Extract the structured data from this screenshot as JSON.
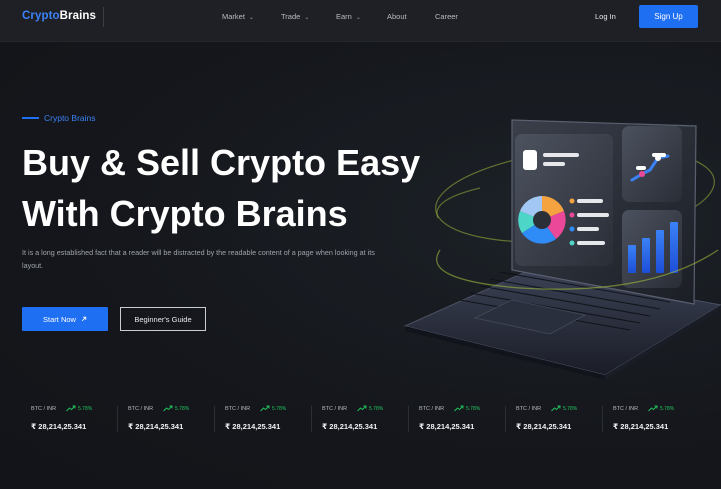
{
  "brand": {
    "part1": "Crypto",
    "part2": "Brains"
  },
  "nav": {
    "items": [
      {
        "label": "Market",
        "has_dropdown": true
      },
      {
        "label": "Trade",
        "has_dropdown": true
      },
      {
        "label": "Earn",
        "has_dropdown": true
      },
      {
        "label": "About",
        "has_dropdown": false
      },
      {
        "label": "Career",
        "has_dropdown": false
      }
    ],
    "login": "Log In",
    "signup": "Sign Up"
  },
  "hero": {
    "eyebrow": "Crypto Brains",
    "title_line1": "Buy & Sell Crypto Easy",
    "title_line2": "With Crypto Brains",
    "description": "It is a long established fact that a reader will be distracted by the readable content of a page when looking at its layout.",
    "start_button": "Start Now",
    "start_icon": "arrow-up-right-icon",
    "guide_button": "Beginner's Guide"
  },
  "ticker": [
    {
      "pair": "BTC / INR",
      "change": "5.78%",
      "price": "₹ 28,214,25.341"
    },
    {
      "pair": "BTC / INR",
      "change": "5.78%",
      "price": "₹ 28,214,25.341"
    },
    {
      "pair": "BTC / INR",
      "change": "5.78%",
      "price": "₹ 28,214,25.341"
    },
    {
      "pair": "BTC / INR",
      "change": "5.78%",
      "price": "₹ 28,214,25.341"
    },
    {
      "pair": "BTC / INR",
      "change": "5.78%",
      "price": "₹ 28,214,25.341"
    },
    {
      "pair": "BTC / INR",
      "change": "5.78%",
      "price": "₹ 28,214,25.341"
    },
    {
      "pair": "BTC / INR",
      "change": "5.78%",
      "price": "₹ 28,214,25.341"
    }
  ],
  "colors": {
    "accent": "#1f6ff2",
    "positive": "#22c55e",
    "background": "#16181d"
  }
}
